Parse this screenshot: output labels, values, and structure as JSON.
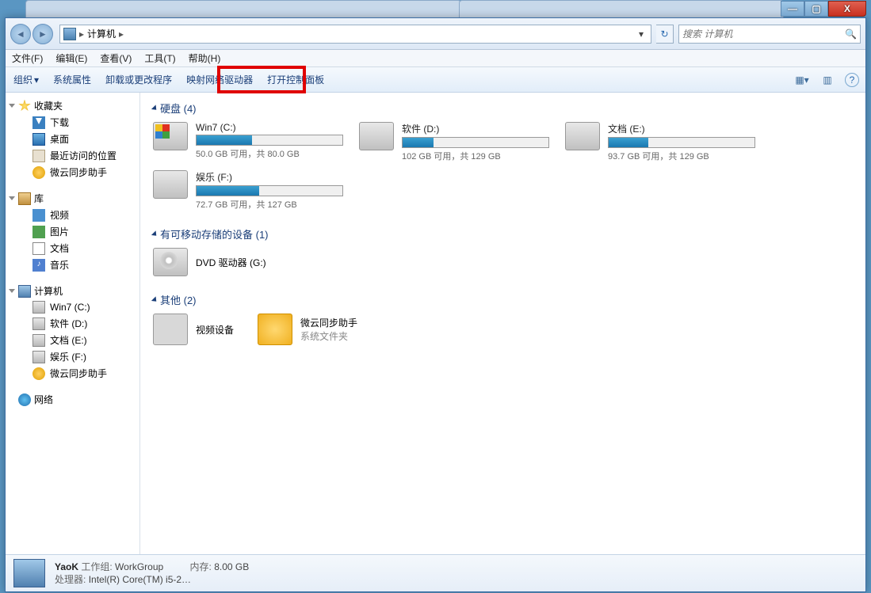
{
  "titlebar": {
    "min": "—",
    "max": "▢",
    "close": "X"
  },
  "nav": {
    "back": "◄",
    "fwd": "►",
    "location_root": "计算机",
    "sep": "▸",
    "dropdown": "▾",
    "refresh": "↻"
  },
  "search": {
    "placeholder": "搜索 计算机",
    "icon": "🔍"
  },
  "menu": {
    "file": "文件(F)",
    "edit": "编辑(E)",
    "view": "查看(V)",
    "tools": "工具(T)",
    "help": "帮助(H)"
  },
  "toolbar": {
    "organize": "组织",
    "org_arrow": "▾",
    "sysprops": "系统属性",
    "uninstall": "卸载或更改程序",
    "mapdrive": "映射网络驱动器",
    "ctrlpanel": "打开控制面板",
    "view_icon": "▦",
    "view_arrow": "▾",
    "preview_icon": "▥",
    "help_icon": "?"
  },
  "sidebar": {
    "fav": "收藏夹",
    "fav_items": [
      "下载",
      "桌面",
      "最近访问的位置",
      "微云同步助手"
    ],
    "lib": "库",
    "lib_items": [
      "视频",
      "图片",
      "文档",
      "音乐"
    ],
    "computer": "计算机",
    "comp_items": [
      "Win7 (C:)",
      "软件 (D:)",
      "文档 (E:)",
      "娱乐 (F:)",
      "微云同步助手"
    ],
    "network": "网络"
  },
  "content": {
    "cat_hdd": "硬盘 (4)",
    "drives": [
      {
        "name": "Win7 (C:)",
        "free": "50.0 GB 可用，共 80.0 GB",
        "pct": 38
      },
      {
        "name": "软件 (D:)",
        "free": "102 GB 可用，共 129 GB",
        "pct": 21
      },
      {
        "name": "文档 (E:)",
        "free": "93.7 GB 可用，共 129 GB",
        "pct": 27
      },
      {
        "name": "娱乐 (F:)",
        "free": "72.7 GB 可用，共 127 GB",
        "pct": 43
      }
    ],
    "cat_removable": "有可移动存储的设备 (1)",
    "dvd": "DVD 驱动器 (G:)",
    "cat_other": "其他 (2)",
    "others": [
      {
        "name": "视频设备",
        "sub": ""
      },
      {
        "name": "微云同步助手",
        "sub": "系统文件夹"
      }
    ]
  },
  "status": {
    "name": "YaoK",
    "wg_lbl": "工作组:",
    "wg": "WorkGroup",
    "cpu_lbl": "处理器:",
    "cpu": "Intel(R) Core(TM) i5-2…",
    "mem_lbl": "内存:",
    "mem": "8.00 GB"
  }
}
